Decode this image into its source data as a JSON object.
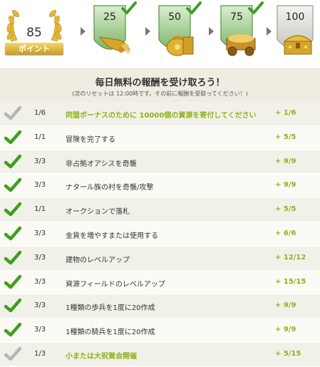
{
  "points": {
    "value": "85",
    "label": "ポイント"
  },
  "milestones": [
    {
      "value": "25",
      "icon": "cornucopia-icon"
    },
    {
      "value": "50",
      "icon": "money-bag-icon"
    },
    {
      "value": "75",
      "icon": "treasure-cart-icon"
    },
    {
      "value": "100",
      "icon": "treasure-chest-icon"
    }
  ],
  "header": {
    "title": "毎日無料の報酬を受け取ろう！",
    "subtitle": "(次のリセットは 12:00時です。その前に報酬を受取ってください！)"
  },
  "tasks": [
    {
      "progress": "1/6",
      "description": "同盟ボーナスのために 10000個の資源を寄付してください",
      "reward": "+ 1/6",
      "complete": false
    },
    {
      "progress": "1/1",
      "description": "冒険を完了する",
      "reward": "+ 5/5",
      "complete": true
    },
    {
      "progress": "3/3",
      "description": "非占拠オアシスを奇襲",
      "reward": "+ 9/9",
      "complete": true
    },
    {
      "progress": "3/3",
      "description": "ナタール族の村を奇襲/攻撃",
      "reward": "+ 9/9",
      "complete": true
    },
    {
      "progress": "1/1",
      "description": "オークションで落札",
      "reward": "+ 5/5",
      "complete": true
    },
    {
      "progress": "3/3",
      "description": "金貨を増やすまたは使用する",
      "reward": "+ 6/6",
      "complete": true
    },
    {
      "progress": "3/3",
      "description": "建物のレベルアップ",
      "reward": "+ 12/12",
      "complete": true
    },
    {
      "progress": "3/3",
      "description": "資源フィールドのレベルアップ",
      "reward": "+ 15/15",
      "complete": true
    },
    {
      "progress": "3/3",
      "description": "1種類の歩兵を1度に20作成",
      "reward": "+ 9/9",
      "complete": true
    },
    {
      "progress": "3/3",
      "description": "1種類の騎兵を1度に20作成",
      "reward": "+ 9/9",
      "complete": true
    },
    {
      "progress": "1/3",
      "description": "小または大祝賀会開催",
      "reward": "+ 5/15",
      "complete": false
    }
  ],
  "colors": {
    "accent_green": "#8fb21a",
    "check_green": "#3e9f1c",
    "check_gray": "#b5b5b5",
    "gold": "#d8a827"
  }
}
